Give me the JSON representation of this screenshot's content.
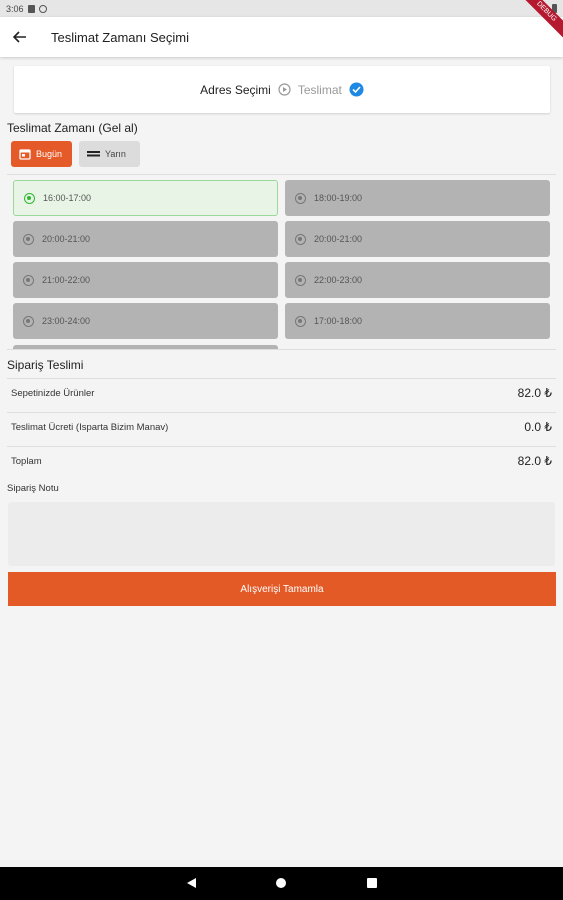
{
  "status_bar": {
    "time": "3:06"
  },
  "debug_banner": "DEBUG",
  "app_bar": {
    "title": "Teslimat Zamanı Seçimi",
    "back_icon": "arrow-left-icon"
  },
  "stepper": {
    "step1_label": "Adres Seçimi",
    "step2_label": "Teslimat",
    "accent_color": "#1e88e5"
  },
  "delivery_time": {
    "title": "Teslimat Zamanı (Gel al)",
    "day_buttons": [
      {
        "label": "Bugün",
        "selected": true
      },
      {
        "label": "Yarın",
        "selected": false
      }
    ],
    "slots": [
      {
        "label": "16:00-17:00",
        "selected": true
      },
      {
        "label": "18:00-19:00",
        "selected": false
      },
      {
        "label": "20:00-21:00",
        "selected": false
      },
      {
        "label": "20:00-21:00",
        "selected": false
      },
      {
        "label": "21:00-22:00",
        "selected": false
      },
      {
        "label": "22:00-23:00",
        "selected": false
      },
      {
        "label": "23:00-24:00",
        "selected": false
      },
      {
        "label": "17:00-18:00",
        "selected": false
      }
    ]
  },
  "order": {
    "title": "Sipariş Teslimi",
    "rows": [
      {
        "label": "Sepetinizde Ürünler",
        "value": "82.0 ₺"
      },
      {
        "label": "Teslimat Ücreti (Isparta Bizim Manav)",
        "value": "0.0 ₺"
      },
      {
        "label": "Toplam",
        "value": "82.0 ₺"
      }
    ],
    "note_label": "Sipariş Notu",
    "note_value": ""
  },
  "submit_label": "Alışverişi Tamamla",
  "colors": {
    "primary": "#e35a27",
    "selected_slot": "#e8f5e6",
    "slot_bg": "#b3b3b3"
  }
}
